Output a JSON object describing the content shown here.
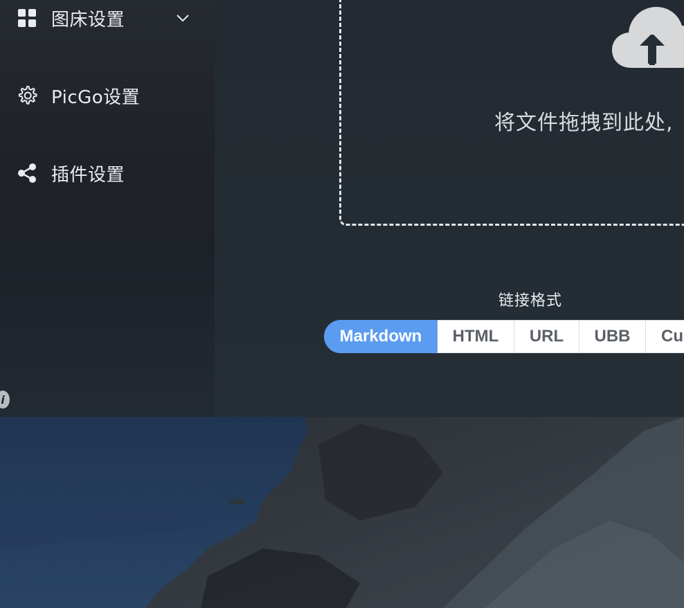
{
  "sidebar": {
    "items": [
      {
        "label": "图床设置",
        "icon": "grid-icon",
        "expandable": true
      },
      {
        "label": "PicGo设置",
        "icon": "gear-icon"
      },
      {
        "label": "插件设置",
        "icon": "share-icon"
      }
    ]
  },
  "upload": {
    "drop_text": "将文件拖拽到此处,",
    "icon": "cloud-upload-icon"
  },
  "link_format": {
    "title": "链接格式",
    "options": [
      "Markdown",
      "HTML",
      "URL",
      "UBB",
      "Cu"
    ],
    "selected": "Markdown"
  },
  "colors": {
    "accent": "#5b9cf0",
    "sidebar_bg": "#1f2329",
    "main_bg": "#252e35"
  }
}
